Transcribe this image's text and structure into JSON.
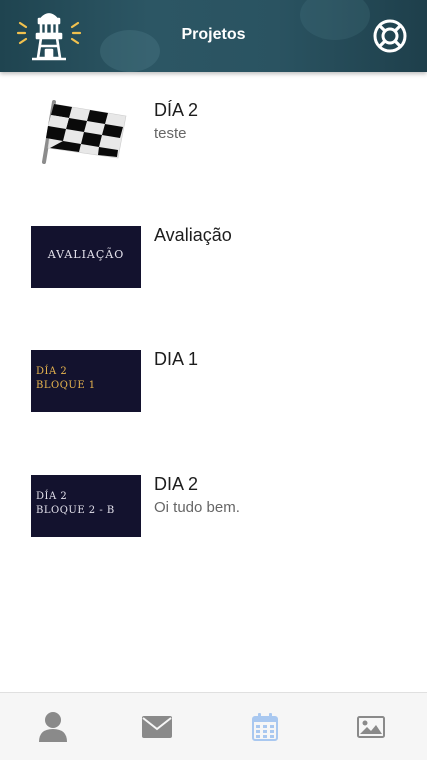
{
  "header": {
    "title": "Projetos",
    "logo_icon": "lighthouse-icon",
    "help_icon": "lifebuoy-icon"
  },
  "projects": [
    {
      "title": "DÍA 2",
      "subtitle": "teste",
      "thumbnail": "checkered-flag"
    },
    {
      "title": "Avaliação",
      "subtitle": "",
      "thumbnail_text": "AVALIAÇÃO"
    },
    {
      "title": "DIA 1",
      "subtitle": "",
      "thumbnail_lines": [
        "DÍA 2",
        "BLOQUE 1"
      ]
    },
    {
      "title": "DIA 2",
      "subtitle": "Oi tudo bem.",
      "thumbnail_lines": [
        "DÍA 2",
        "BLOQUE 2 - B"
      ]
    }
  ],
  "tabs": [
    {
      "icon": "user-icon",
      "active": false
    },
    {
      "icon": "mail-icon",
      "active": false
    },
    {
      "icon": "calendar-icon",
      "active": true
    },
    {
      "icon": "image-icon",
      "active": false
    }
  ],
  "colors": {
    "header_bg": "#2c5664",
    "thumbnail_bg": "#13122e",
    "thumbnail_gold": "#e7b44e",
    "tab_active": "#a9c8f0",
    "tab_inactive": "#8a8a8a"
  }
}
